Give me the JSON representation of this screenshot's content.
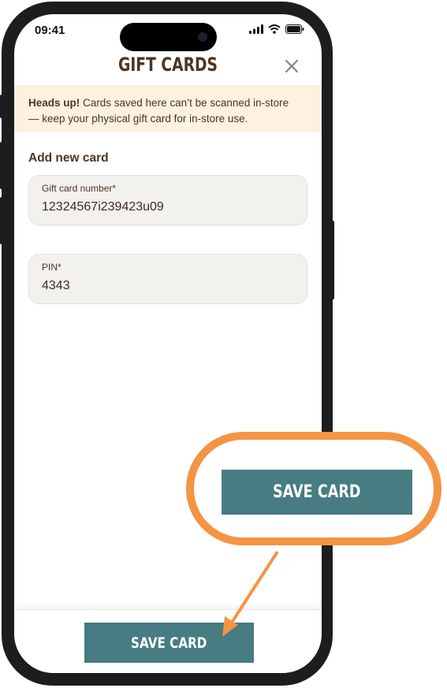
{
  "status_bar": {
    "time": "09:41"
  },
  "header": {
    "title": "GIFT CARDS",
    "close_icon": "close-icon"
  },
  "banner": {
    "bold": "Heads up!",
    "line1_rest": " Cards saved here can’t be scanned in-store",
    "line2": "— keep your physical gift card for in-store use."
  },
  "form": {
    "section_title": "Add new card",
    "card_number": {
      "label": "Gift card number*",
      "value": "12324567i239423u09"
    },
    "pin": {
      "label": "PIN*",
      "value": "4343"
    }
  },
  "footer": {
    "save_label": "SAVE CARD"
  },
  "callout": {
    "save_label": "SAVE CARD",
    "ring_color": "#f49445",
    "button_color": "#467c82"
  }
}
